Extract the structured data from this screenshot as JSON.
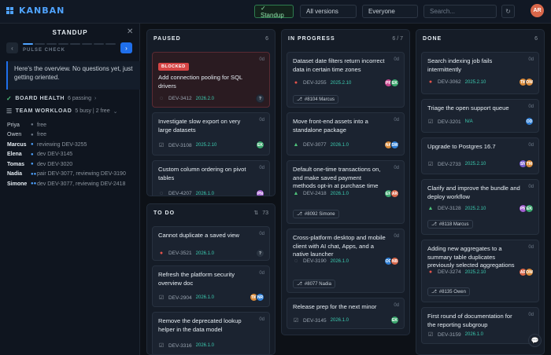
{
  "app": {
    "title": "KANBAN"
  },
  "topbar": {
    "standup_label": "✓ Standup",
    "versions_label": "All versions",
    "people_label": "Everyone",
    "search_placeholder": "Search...",
    "user_initials": "AR"
  },
  "sidebar": {
    "title": "STANDUP",
    "step_label": "PULSE CHECK",
    "progress_step": 1,
    "progress_total": 8,
    "note": "Here's the overview. No questions yet, just getting oriented.",
    "board_health": {
      "label": "BOARD HEALTH",
      "detail": "6 passing"
    },
    "team_workload": {
      "label": "TEAM WORKLOAD",
      "detail": "5 busy | 2 free"
    },
    "workers": [
      {
        "name": "Priya",
        "task": "free",
        "busy": false
      },
      {
        "name": "Owen",
        "task": "free",
        "busy": false
      },
      {
        "name": "Marcus",
        "task": "reviewing DEV-3255",
        "busy": true
      },
      {
        "name": "Elena",
        "task": "dev DEV-3145",
        "busy": true
      },
      {
        "name": "Tomas",
        "task": "dev DEV-3020",
        "busy": true
      },
      {
        "name": "Nadia",
        "task": "pair DEV-3077, reviewing DEV-3190",
        "busy": true
      },
      {
        "name": "Simone",
        "task": "dev DEV-3077, reviewing DEV-2418",
        "busy": true
      }
    ]
  },
  "columns": {
    "paused": {
      "title": "PAUSED",
      "count": "6",
      "cards": [
        {
          "title": "Add connection pooling for SQL drivers",
          "badge": "BLOCKED",
          "age": "0d",
          "id": "DEV-3412",
          "version": "2026.2.0",
          "avatars": [
            "?"
          ]
        },
        {
          "title": "Investigate slow export on very large datasets",
          "age": "0d",
          "id": "DEV-3108",
          "version": "2025.2.10",
          "avatars": [
            "EK"
          ]
        },
        {
          "title": "Custom column ordering on pivot tables",
          "age": "0d",
          "id": "DEV-4207",
          "version": "2026.1.0",
          "avatars": [
            "PN"
          ]
        }
      ]
    },
    "todo": {
      "title": "TO DO",
      "count": "73",
      "cards": [
        {
          "title": "Cannot duplicate a saved view",
          "age": "0d",
          "id": "DEV-3521",
          "version": "2026.1.0",
          "avatars": [
            "?"
          ]
        },
        {
          "title": "Refresh the platform security overview doc",
          "age": "0d",
          "id": "DEV-2904",
          "version": "2026.1.0",
          "avatars": [
            "TM",
            "NR"
          ]
        },
        {
          "title": "Remove the deprecated lookup helper in the data model",
          "age": "0d",
          "id": "DEV-3316",
          "version": "2026.1.0",
          "avatars": []
        }
      ]
    },
    "progress": {
      "title": "IN PROGRESS",
      "count": "6 / 7",
      "cards": [
        {
          "title": "Dataset date filters return incorrect data in certain time zones",
          "age": "0d",
          "id": "DEV-3255",
          "version": "2025.2.10",
          "avatars": [
            "PR",
            "EK"
          ],
          "ref": "#8104 Marcus"
        },
        {
          "title": "Move front-end assets into a standalone package",
          "age": "0d",
          "id": "DEV-3077",
          "version": "2026.1.0",
          "avatars": [
            "NA",
            "SW"
          ]
        },
        {
          "title": "Default one-time transactions on, and make saved payment methods opt-in at purchase time",
          "age": "0d",
          "id": "DEV-2418",
          "version": "2026.1.0",
          "avatars": [
            "EN",
            "AR"
          ],
          "ref": "#8092 Simone"
        },
        {
          "title": "Cross-platform desktop and mobile client with AI chat, Apps, and a native launcher",
          "age": "0d",
          "id": "DEV-3190",
          "version": "2026.1.0",
          "avatars": [
            "OC",
            "NB"
          ],
          "ref": "#8077 Nadia"
        },
        {
          "title": "Release prep for the next minor",
          "age": "0d",
          "id": "DEV-3145",
          "version": "2026.1.0",
          "avatars": [
            "EK"
          ]
        }
      ]
    },
    "done": {
      "title": "DONE",
      "count": "6",
      "cards": [
        {
          "title": "Search indexing job fails intermittently",
          "age": "0d",
          "id": "DEV-3062",
          "version": "2025.2.10",
          "avatars": [
            "TM",
            "OW"
          ]
        },
        {
          "title": "Triage the open support queue",
          "age": "0d",
          "id": "DEV-3201",
          "version": "N/A",
          "avatars": [
            "OD"
          ]
        },
        {
          "title": "Upgrade to Postgres 16.7",
          "age": "0d",
          "id": "DEV-2733",
          "version": "2025.2.10",
          "avatars": [
            "SN",
            "TM"
          ]
        },
        {
          "title": "Clarify and improve the bundle and deploy workflow",
          "age": "0d",
          "id": "DEV-3128",
          "version": "2025.2.10",
          "avatars": [
            "PN",
            "EK"
          ],
          "ref": "#8118 Marcus"
        },
        {
          "title": "Adding new aggregates to a summary table duplicates previously selected aggregations",
          "age": "0d",
          "id": "DEV-3274",
          "version": "2025.2.10",
          "avatars": [
            "AR",
            "OW"
          ],
          "ref": "#8135 Owen"
        },
        {
          "title": "First round of documentation for the reporting subgroup",
          "age": "0d",
          "id": "DEV-3159",
          "version": "2026.1.0",
          "avatars": []
        }
      ]
    }
  },
  "colors": {
    "accent": "#1f6feb",
    "blocked": "#d64545",
    "version": "#3ccbb0",
    "avatar": {
      "EK": "#3aa76d",
      "PN": "#a35fd1",
      "TM": "#d98a3a",
      "NR": "#2f7fd6",
      "PR": "#c9478f",
      "NA": "#d98a3a",
      "SW": "#2f7fd6",
      "EN": "#3aa76d",
      "AR": "#d9674a",
      "OC": "#2f7fd6",
      "NB": "#d9674a",
      "OW": "#d98a3a",
      "OD": "#2f7fd6",
      "SN": "#7a5fd1",
      "?": "#2a3441"
    }
  }
}
